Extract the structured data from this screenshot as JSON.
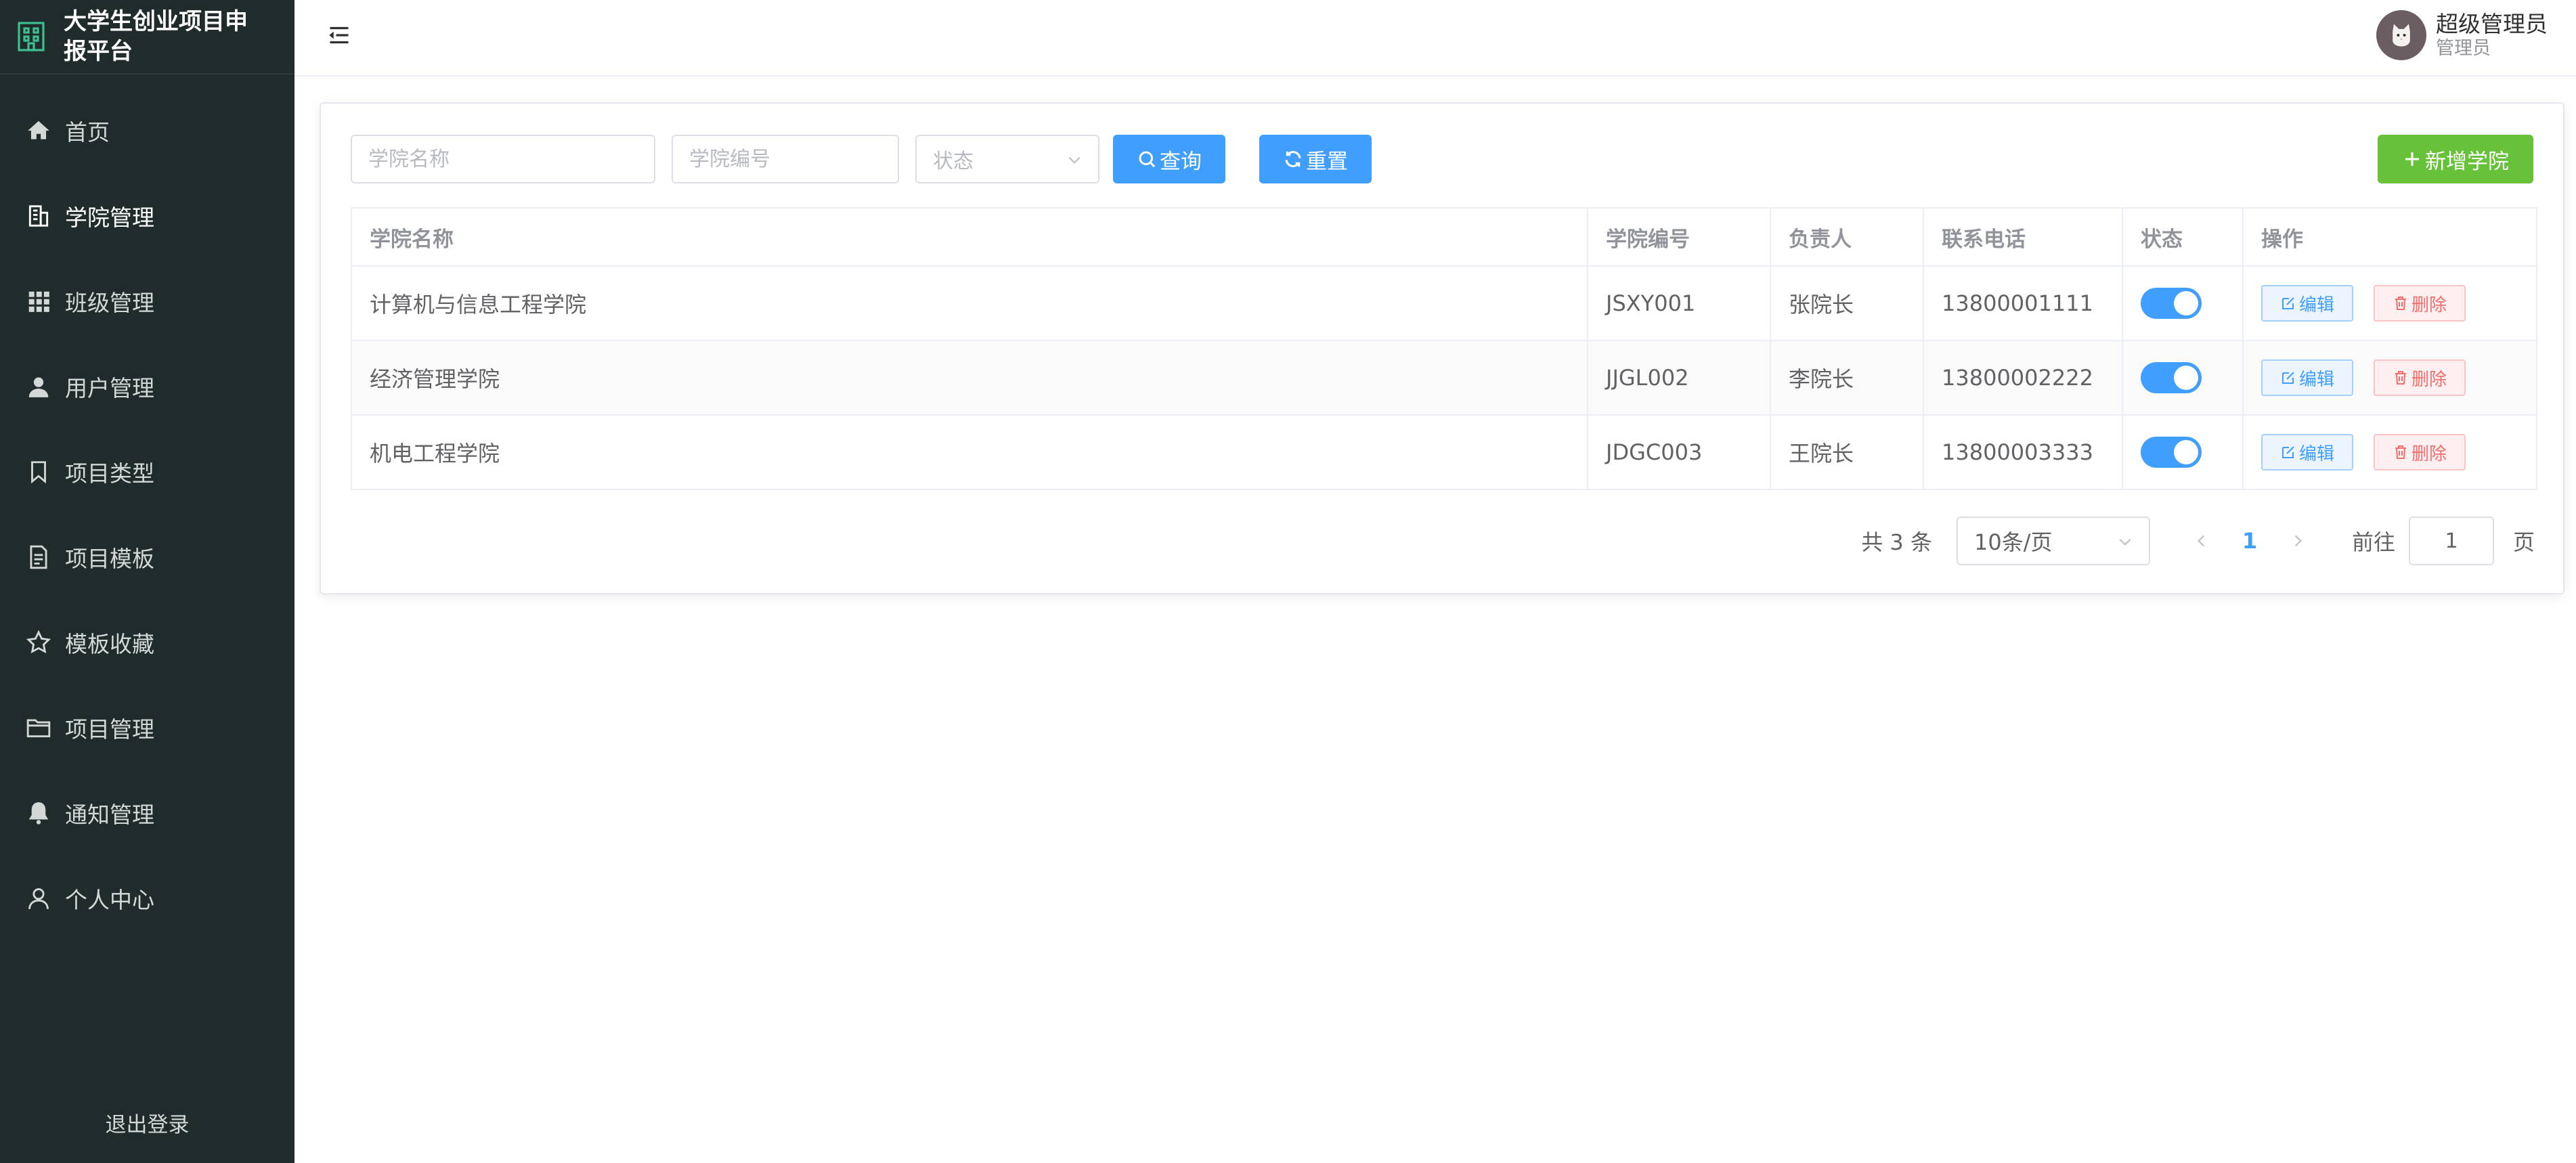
{
  "app": {
    "title": "大学生创业项目申报平台"
  },
  "sidebar": {
    "items": [
      {
        "label": "首页",
        "icon": "home-icon"
      },
      {
        "label": "学院管理",
        "icon": "building-icon",
        "active": true
      },
      {
        "label": "班级管理",
        "icon": "grid-icon"
      },
      {
        "label": "用户管理",
        "icon": "user-icon"
      },
      {
        "label": "项目类型",
        "icon": "bookmark-icon"
      },
      {
        "label": "项目模板",
        "icon": "document-icon"
      },
      {
        "label": "模板收藏",
        "icon": "star-icon"
      },
      {
        "label": "项目管理",
        "icon": "folder-icon"
      },
      {
        "label": "通知管理",
        "icon": "bell-icon"
      },
      {
        "label": "个人中心",
        "icon": "person-icon"
      }
    ],
    "logout_label": "退出登录"
  },
  "header": {
    "user_name": "超级管理员",
    "user_role": "管理员"
  },
  "filters": {
    "name_placeholder": "学院名称",
    "code_placeholder": "学院编号",
    "status_placeholder": "状态",
    "search_label": "查询",
    "reset_label": "重置",
    "add_label": "新增学院"
  },
  "table": {
    "columns": [
      "学院名称",
      "学院编号",
      "负责人",
      "联系电话",
      "状态",
      "操作"
    ],
    "rows": [
      {
        "name": "计算机与信息工程学院",
        "code": "JSXY001",
        "leader": "张院长",
        "phone": "13800001111",
        "enabled": true
      },
      {
        "name": "经济管理学院",
        "code": "JJGL002",
        "leader": "李院长",
        "phone": "13800002222",
        "enabled": true
      },
      {
        "name": "机电工程学院",
        "code": "JDGC003",
        "leader": "王院长",
        "phone": "13800003333",
        "enabled": true
      }
    ],
    "edit_label": "编辑",
    "delete_label": "删除"
  },
  "pagination": {
    "total_text": "共 3 条",
    "page_size": "10条/页",
    "current_page": "1",
    "goto_prefix": "前往",
    "goto_value": "1",
    "goto_suffix": "页"
  },
  "colors": {
    "sidebar_bg": "#202c2b",
    "primary": "#409eff",
    "success": "#67c23a",
    "danger": "#f56c6c"
  }
}
